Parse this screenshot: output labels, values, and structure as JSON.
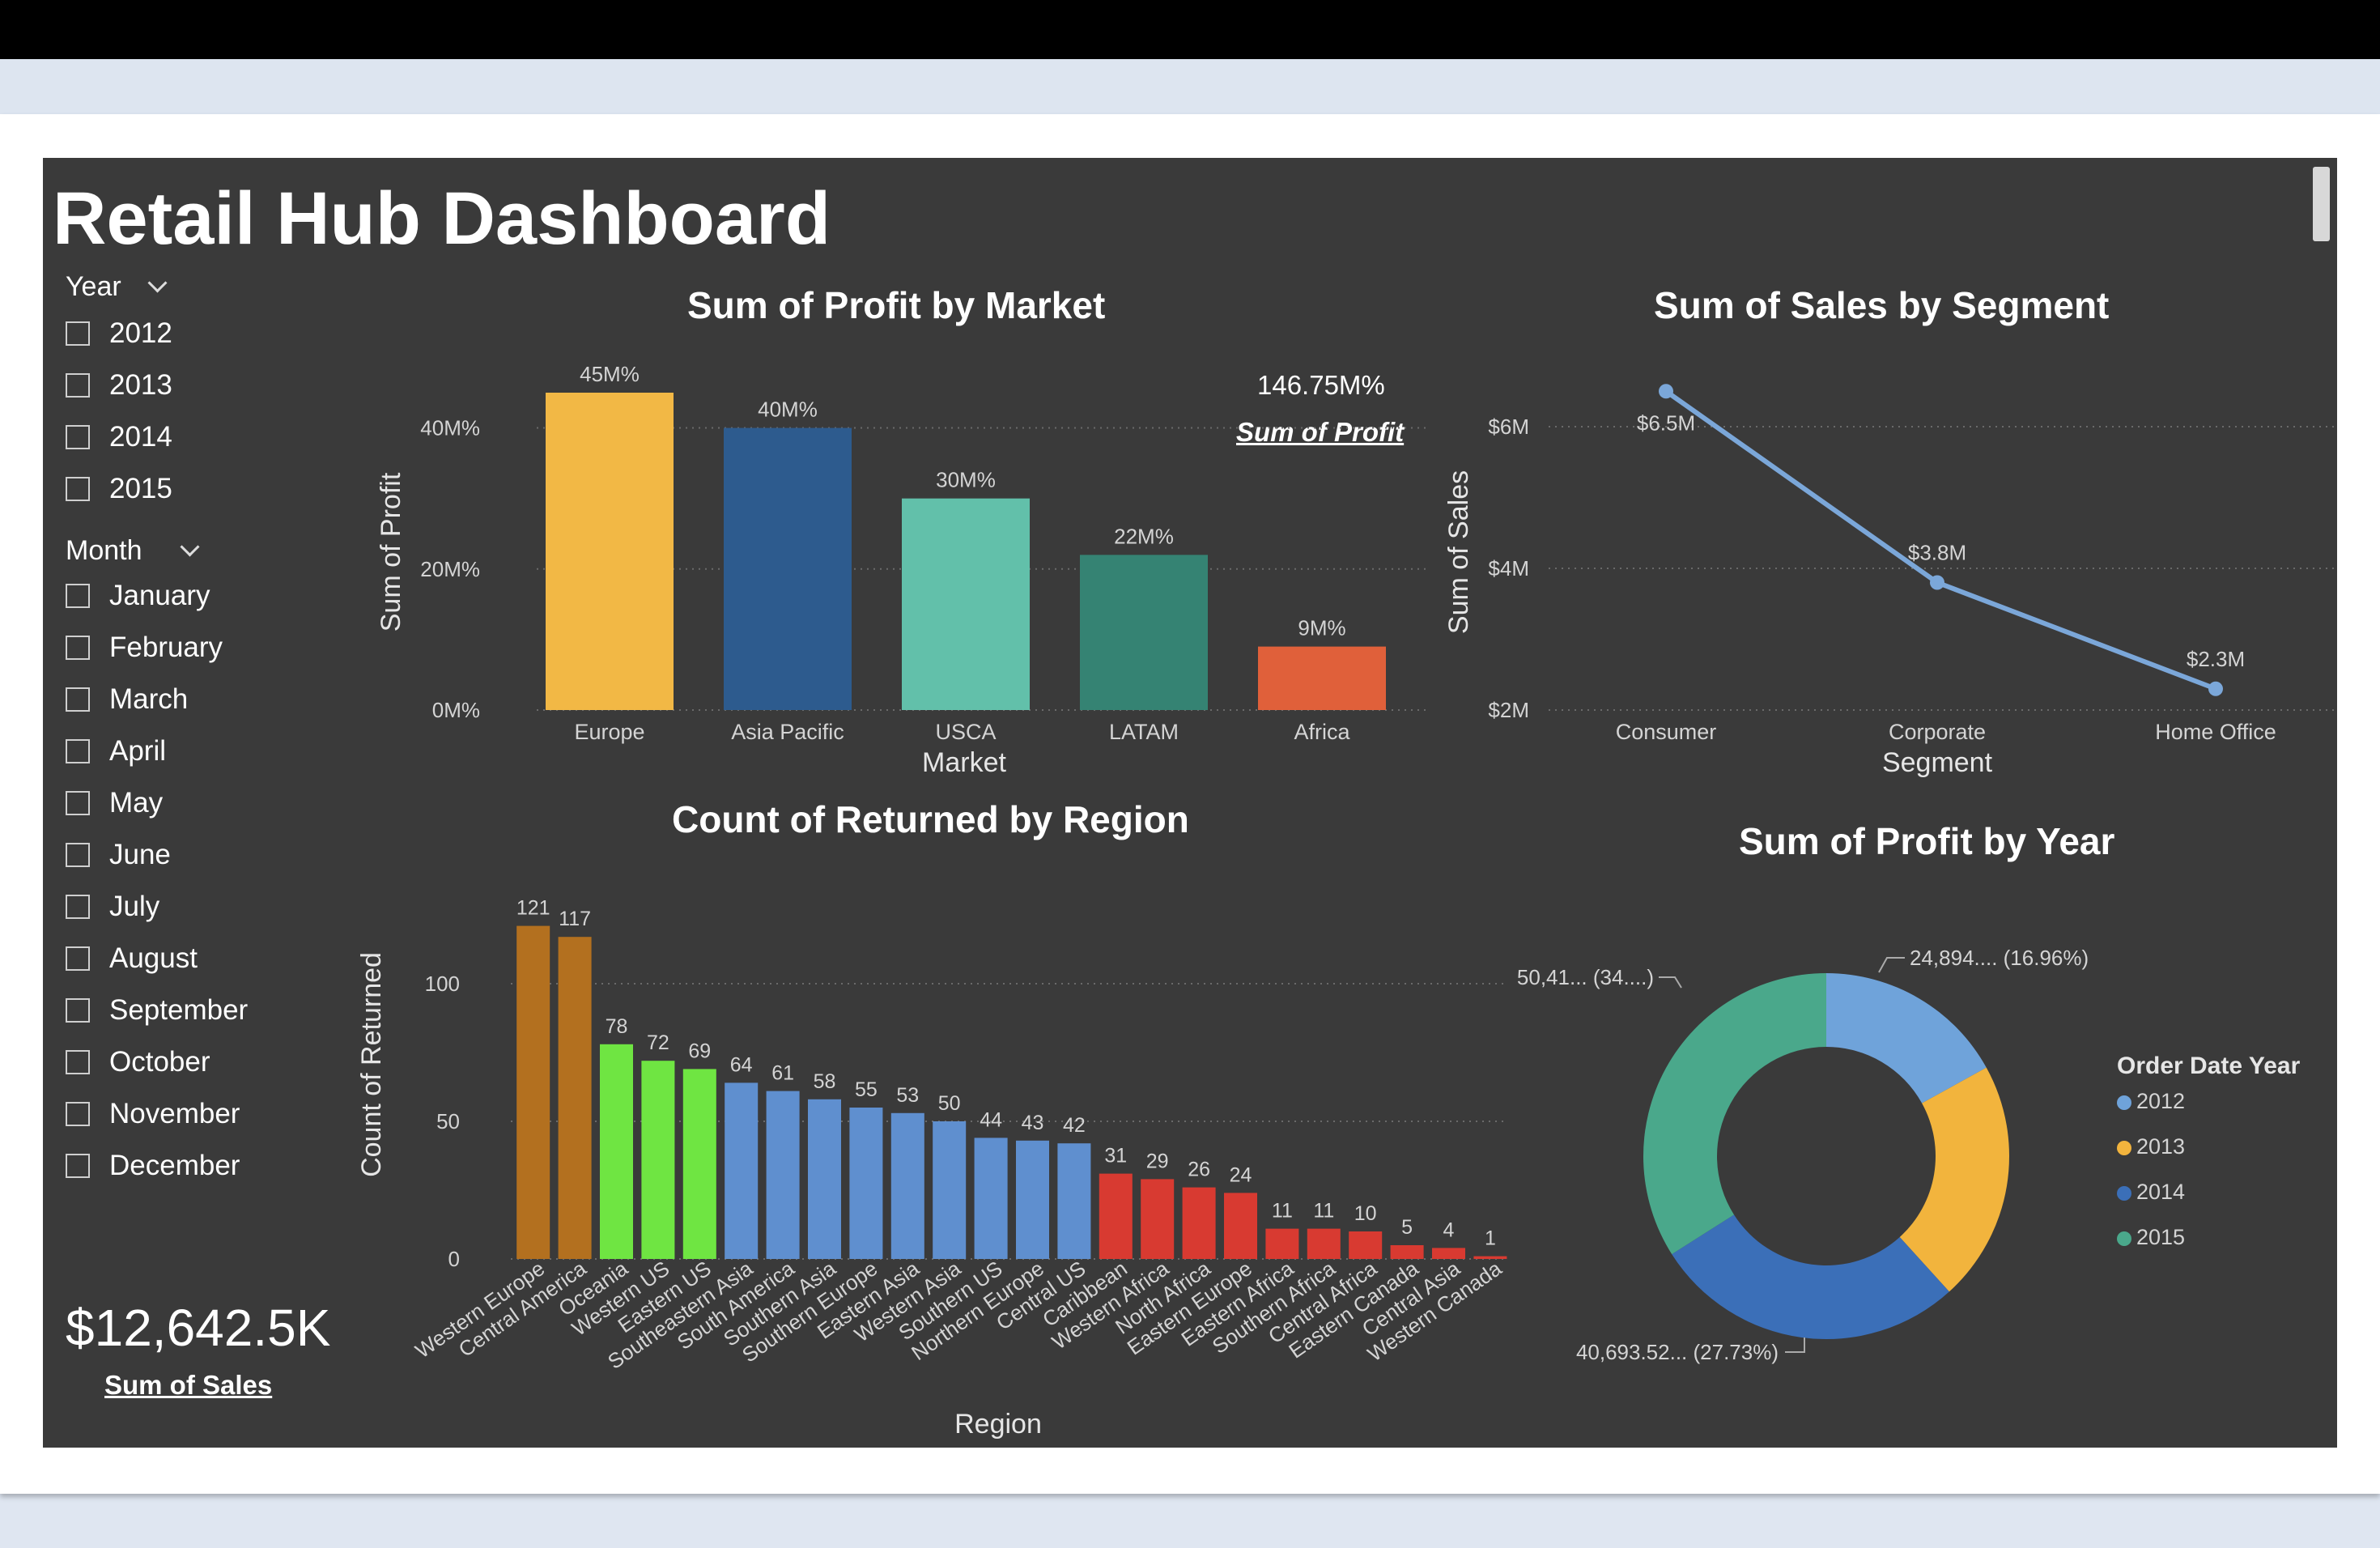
{
  "dashboard": {
    "title": "Retail Hub Dashboard"
  },
  "slicers": {
    "year": {
      "label": "Year",
      "options": [
        "2012",
        "2013",
        "2014",
        "2015"
      ]
    },
    "month": {
      "label": "Month",
      "options": [
        "January",
        "February",
        "March",
        "April",
        "May",
        "June",
        "July",
        "August",
        "September",
        "October",
        "November",
        "December"
      ]
    }
  },
  "kpi_sales": {
    "value": "$12,642.5K",
    "label": "Sum of Sales"
  },
  "kpi_profit": {
    "value": "146.75M%",
    "label": "Sum of Profit"
  },
  "colors": {
    "background": "#3a3a3a",
    "text": "#ffffff",
    "muted": "#d4d4d4"
  },
  "chart_data": [
    {
      "id": "profit_by_market",
      "type": "bar",
      "title": "Sum of Profit by Market",
      "xlabel": "Market",
      "ylabel": "Sum of Profit",
      "categories": [
        "Europe",
        "Asia Pacific",
        "USCA",
        "LATAM",
        "Africa"
      ],
      "values": [
        45,
        40,
        30,
        22,
        9
      ],
      "value_labels": [
        "45M%",
        "40M%",
        "30M%",
        "22M%",
        "9M%"
      ],
      "colors": [
        "#f2b845",
        "#2d5b8e",
        "#62c0aa",
        "#358373",
        "#e0603a"
      ],
      "yticks": [
        0,
        20,
        40
      ],
      "ytick_labels": [
        "0M%",
        "20M%",
        "40M%"
      ],
      "ylim": [
        0,
        45
      ],
      "grid": true
    },
    {
      "id": "sales_by_segment",
      "type": "line",
      "title": "Sum of Sales by Segment",
      "xlabel": "Segment",
      "ylabel": "Sum of Sales",
      "categories": [
        "Consumer",
        "Corporate",
        "Home Office"
      ],
      "values": [
        6.5,
        3.8,
        2.3
      ],
      "value_labels": [
        "$6.5M",
        "$3.8M",
        "$2.3M"
      ],
      "yticks": [
        2,
        4,
        6
      ],
      "ytick_labels": [
        "$2M",
        "$4M",
        "$6M"
      ],
      "ylim": [
        2,
        6.5
      ],
      "color": "#7ba7d9",
      "grid": true
    },
    {
      "id": "returned_by_region",
      "type": "bar",
      "title": "Count of Returned by Region",
      "xlabel": "Region",
      "ylabel": "Count of Returned",
      "categories": [
        "Western Europe",
        "Central America",
        "Oceania",
        "Western US",
        "Eastern US",
        "Southeastern Asia",
        "South America",
        "Southern Asia",
        "Southern Europe",
        "Eastern Asia",
        "Western Asia",
        "Southern US",
        "Northern Europe",
        "Central US",
        "Caribbean",
        "Western Africa",
        "North Africa",
        "Eastern Europe",
        "Eastern Africa",
        "Southern Africa",
        "Central Africa",
        "Eastern Canada",
        "Central Asia",
        "Western Canada"
      ],
      "values": [
        121,
        117,
        78,
        72,
        69,
        64,
        61,
        58,
        55,
        53,
        50,
        44,
        43,
        42,
        31,
        29,
        26,
        24,
        11,
        11,
        10,
        5,
        4,
        1
      ],
      "colors": [
        "#b3701f",
        "#b3701f",
        "#6fe542",
        "#6fe542",
        "#6fe542",
        "#5f8fcf",
        "#5f8fcf",
        "#5f8fcf",
        "#5f8fcf",
        "#5f8fcf",
        "#5f8fcf",
        "#5f8fcf",
        "#5f8fcf",
        "#5f8fcf",
        "#d83a31",
        "#d83a31",
        "#d83a31",
        "#d83a31",
        "#d83a31",
        "#d83a31",
        "#d83a31",
        "#d83a31",
        "#d83a31",
        "#d83a31"
      ],
      "yticks": [
        0,
        50,
        100
      ],
      "ylim": [
        0,
        121
      ],
      "grid": true
    },
    {
      "id": "profit_by_year",
      "type": "pie",
      "donut": true,
      "title": "Sum of Profit by Year",
      "legend_title": "Order Date Year",
      "legend_position": "right",
      "labels": [
        "2012",
        "2013",
        "2014",
        "2015"
      ],
      "values": [
        16.96,
        21.31,
        27.73,
        34.0
      ],
      "colors": [
        "#6fa3da",
        "#f2b43d",
        "#3b6fb8",
        "#4aa88b"
      ],
      "data_labels": [
        "24,894.... (16.96%)",
        "",
        "40,693.52... (27.73%)",
        "50,41... (34....)"
      ]
    }
  ]
}
